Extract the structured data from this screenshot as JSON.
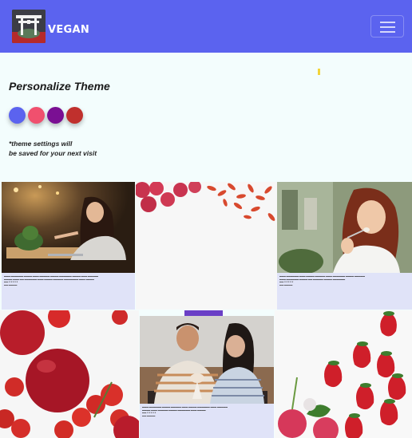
{
  "navbar": {
    "brand": "VEGAN",
    "logo_icon": "torii-gate-icon",
    "menu_icon": "hamburger-icon",
    "background": "#5b63ef"
  },
  "theme": {
    "title": "Personalize Theme",
    "swatches": [
      {
        "name": "blue",
        "color": "#5b63ef"
      },
      {
        "name": "pink",
        "color": "#f0506e"
      },
      {
        "name": "purple",
        "color": "#7a0f93"
      },
      {
        "name": "red",
        "color": "#c0302d"
      }
    ],
    "note_line1": "*theme settings will",
    "note_line2": "be saved for your next visit"
  },
  "gallery": [
    {
      "image": "woman-eating-cafe-photo",
      "has_caption": true
    },
    {
      "image": "raspberries-goji-berries-photo",
      "has_caption": false
    },
    {
      "image": "woman-eating-fork-photo",
      "has_caption": true
    },
    {
      "image": "apples-tomatoes-photo",
      "has_caption": false
    },
    {
      "image": "couple-sharing-dessert-photo",
      "has_caption": true
    },
    {
      "image": "strawberries-radishes-photo",
      "has_caption": false
    }
  ]
}
